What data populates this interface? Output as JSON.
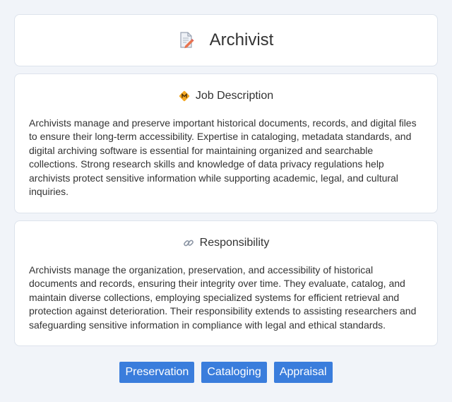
{
  "header": {
    "title": "Archivist",
    "icon": "document-pen-icon"
  },
  "job_description": {
    "heading": "Job Description",
    "icon": "diamond-badge-icon",
    "text": "Archivists manage and preserve important historical documents, records, and digital files to ensure their long-term accessibility. Expertise in cataloging, metadata standards, and digital archiving software is essential for maintaining organized and searchable collections. Strong research skills and knowledge of data privacy regulations help archivists protect sensitive information while supporting academic, legal, and cultural inquiries."
  },
  "responsibility": {
    "heading": "Responsibility",
    "icon": "link-icon",
    "text": "Archivists manage the organization, preservation, and accessibility of historical documents and records, ensuring their integrity over time. They evaluate, catalog, and maintain diverse collections, employing specialized systems for efficient retrieval and protection against deterioration. Their responsibility extends to assisting researchers and safeguarding sensitive information in compliance with legal and ethical standards."
  },
  "tags": [
    "Preservation",
    "Cataloging",
    "Appraisal"
  ],
  "colors": {
    "accent": "#3a7ddc",
    "background": "#f1f4f9"
  }
}
